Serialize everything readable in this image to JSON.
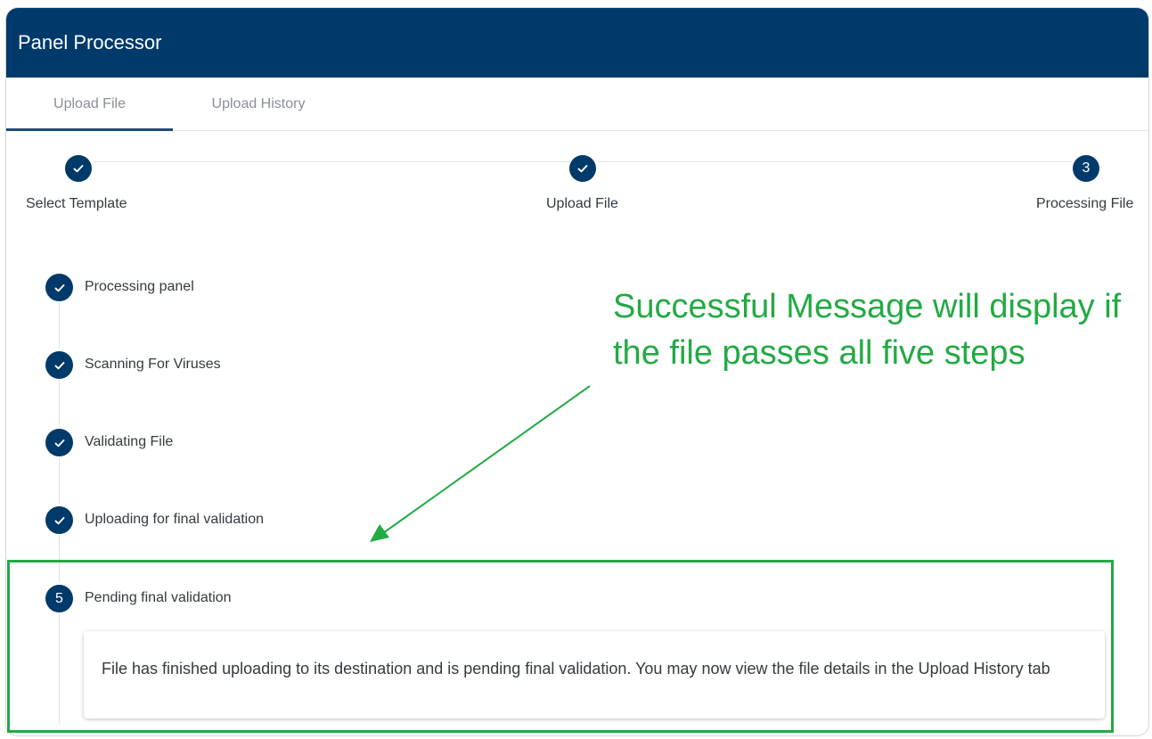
{
  "app": {
    "title": "Panel Processor"
  },
  "tabs": [
    {
      "label": "Upload File",
      "active": true
    },
    {
      "label": "Upload History",
      "active": false
    }
  ],
  "stepper": {
    "steps": [
      {
        "label": "Select Template",
        "state": "complete",
        "icon": "check-icon"
      },
      {
        "label": "Upload File",
        "state": "complete",
        "icon": "check-icon"
      },
      {
        "label": "Processing File",
        "state": "active",
        "number": "3"
      }
    ]
  },
  "processing": {
    "steps": [
      {
        "label": "Processing panel",
        "state": "complete",
        "icon": "check-icon"
      },
      {
        "label": "Scanning For Viruses",
        "state": "complete",
        "icon": "check-icon"
      },
      {
        "label": "Validating File",
        "state": "complete",
        "icon": "check-icon"
      },
      {
        "label": "Uploading for final validation",
        "state": "complete",
        "icon": "check-icon"
      },
      {
        "label": "Pending final validation",
        "state": "active",
        "number": "5"
      }
    ],
    "message": "File has finished uploading to its destination and is pending final validation. You may now view the file details in the Upload History tab"
  },
  "annotation": {
    "text": "Successful Message will display if the file passes all five steps",
    "color": "#22aa44"
  },
  "colors": {
    "header": "#003a6a",
    "step_circle": "#003a6a",
    "annotation": "#22aa44"
  }
}
